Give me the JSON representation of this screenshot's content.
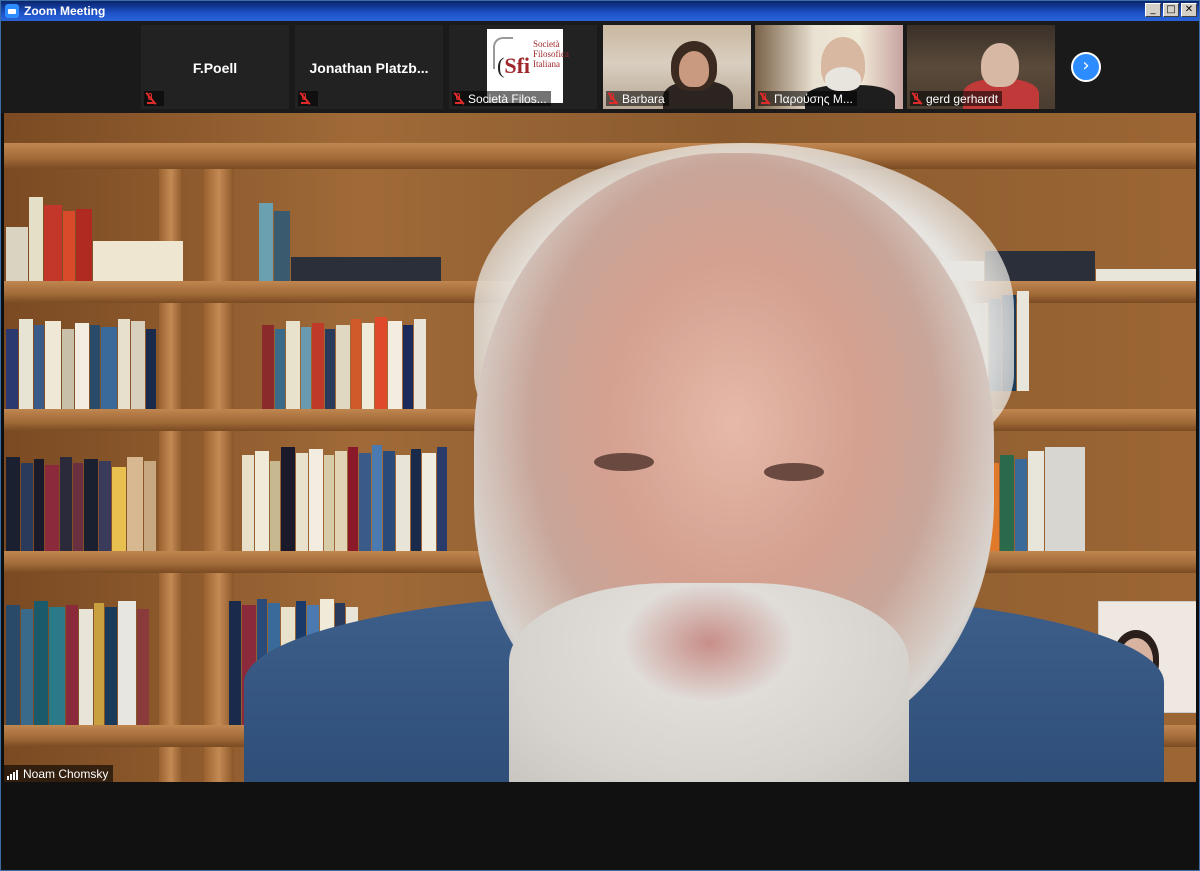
{
  "window": {
    "title": "Zoom Meeting",
    "controls": [
      "_",
      "□",
      "✕"
    ]
  },
  "participants": [
    {
      "name": "F.Poell",
      "footer": "",
      "muted": true,
      "type": "name"
    },
    {
      "name": "Jonathan  Platzb...",
      "footer": "",
      "muted": true,
      "type": "name"
    },
    {
      "name": "",
      "footer": "Società Filos...",
      "muted": true,
      "type": "logo"
    },
    {
      "name": "",
      "footer": "Barbara",
      "muted": true,
      "type": "video"
    },
    {
      "name": "",
      "footer": "Παρούσης Μ...",
      "muted": true,
      "type": "video"
    },
    {
      "name": "",
      "footer": "gerd gerhardt",
      "muted": true,
      "type": "video"
    }
  ],
  "logo": {
    "main": "Sfi",
    "lines": [
      "Società",
      "Filosofica",
      "Italiana"
    ]
  },
  "next_icon": "chevron-right-icon",
  "active_speaker": {
    "name": "Noam Chomsky",
    "icon": "signal-bars-icon"
  },
  "colors": {
    "accent": "#2d8cff",
    "mute": "#e02b2b",
    "titlebar": "#0a246a"
  }
}
